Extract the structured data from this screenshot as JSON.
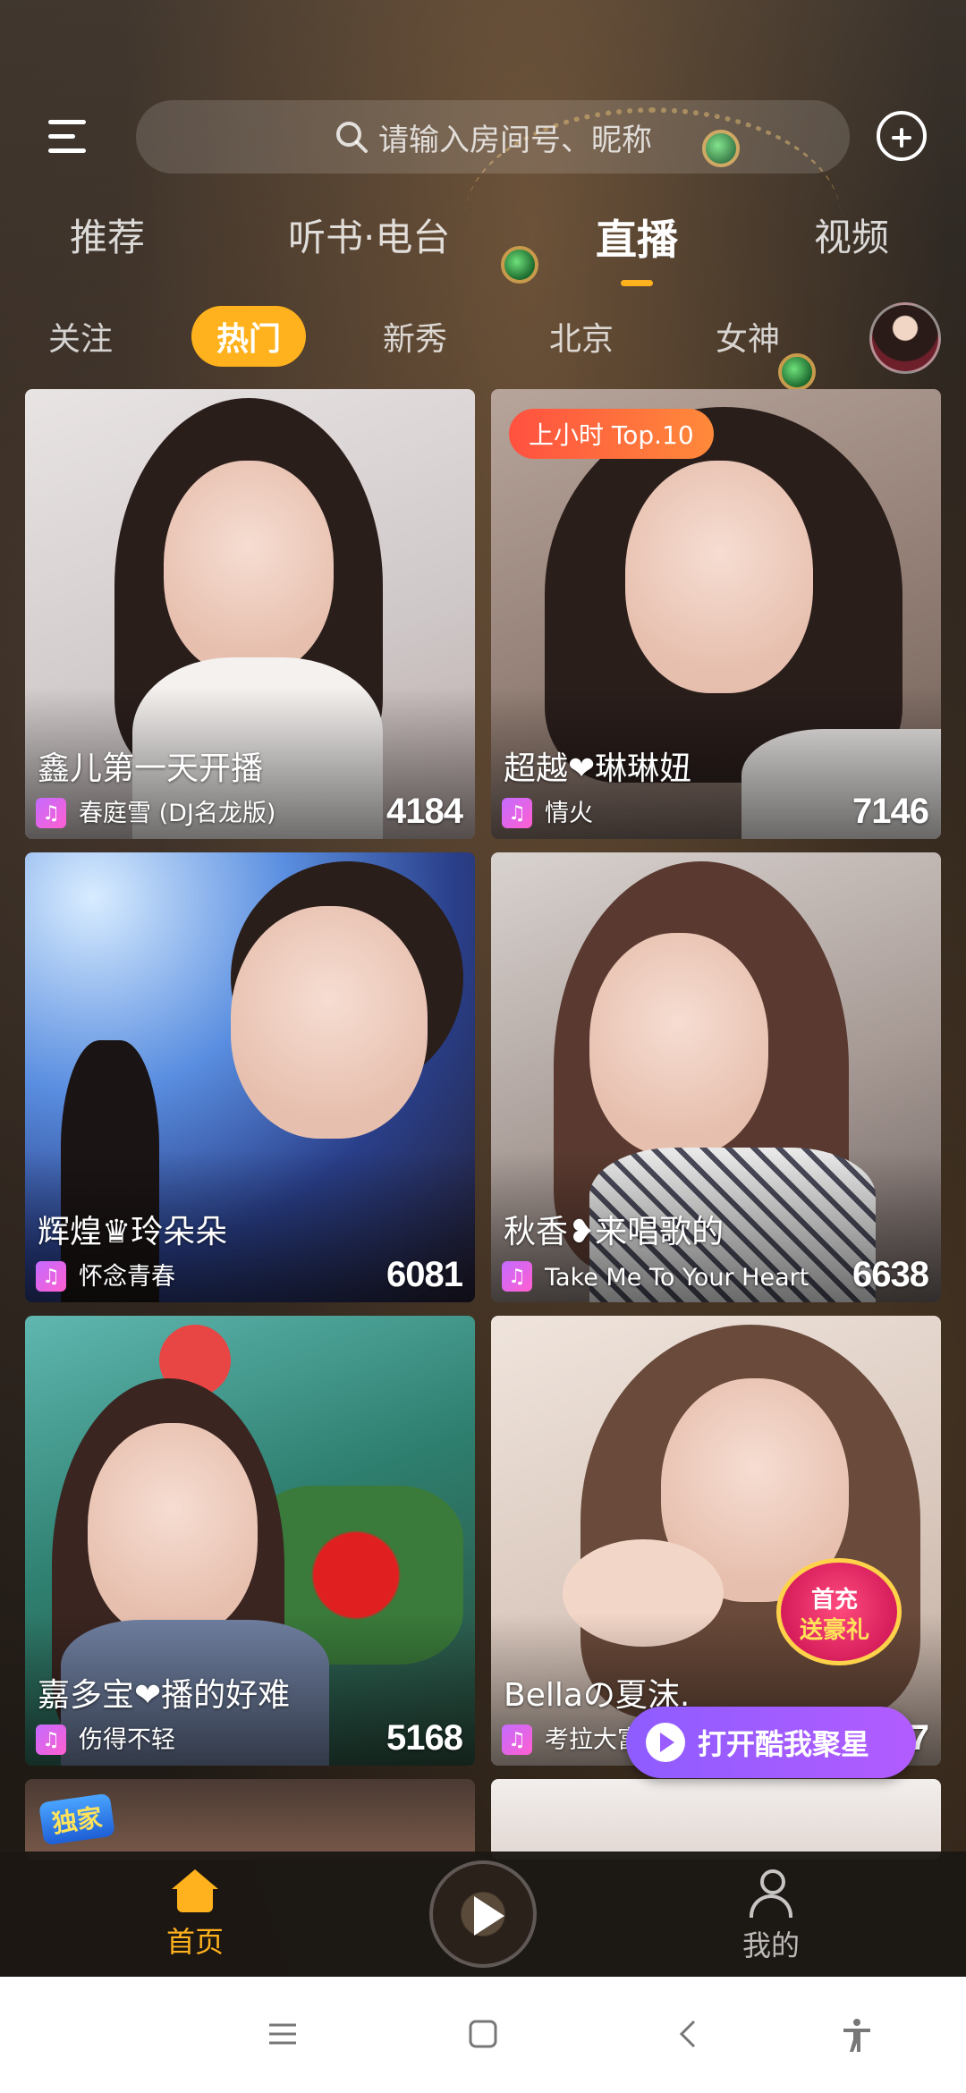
{
  "search": {
    "placeholder": "请输入房间号、昵称"
  },
  "main_tabs": [
    {
      "label": "推荐",
      "active": false
    },
    {
      "label": "听书·电台",
      "active": false
    },
    {
      "label": "直播",
      "active": true
    },
    {
      "label": "视频",
      "active": false
    }
  ],
  "sub_tabs": [
    {
      "label": "关注",
      "active": false
    },
    {
      "label": "热门",
      "active": true
    },
    {
      "label": "新秀",
      "active": false
    },
    {
      "label": "北京",
      "active": false
    },
    {
      "label": "女神",
      "active": false
    }
  ],
  "cards": [
    {
      "title": "鑫儿第一天开播",
      "song": "春庭雪 (DJ名龙版)",
      "viewers": "4184",
      "badge": ""
    },
    {
      "title": "超越❤琳琳妞",
      "song": "情火",
      "viewers": "7146",
      "badge": "上小时 Top.10"
    },
    {
      "title": "辉煌♛玲朵朵",
      "song": "怀念青春",
      "viewers": "6081",
      "badge": ""
    },
    {
      "title": "秋香❥来唱歌的",
      "song": "Take Me To Your Heart",
      "viewers": "6638",
      "badge": ""
    },
    {
      "title": "嘉多宝❤播的好难",
      "song": "伤得不轻",
      "viewers": "5168",
      "badge": ""
    },
    {
      "title": "Bellaの夏沫.",
      "song": "考拉大富",
      "viewers": "7",
      "badge": ""
    }
  ],
  "promo": {
    "line1": "首充",
    "line2": "送豪礼"
  },
  "open_app": {
    "label": "打开酷我聚星"
  },
  "exclusive_badge": "独家",
  "bottom_nav": {
    "home": "首页",
    "mine": "我的"
  },
  "colors": {
    "accent": "#ffb21d",
    "badge_red": "#ff5140",
    "promo_purple": "#9b5cff"
  }
}
